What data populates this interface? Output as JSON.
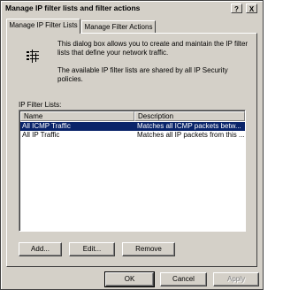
{
  "window": {
    "title": "Manage IP filter lists and filter actions",
    "help_glyph": "?",
    "close_glyph": "X"
  },
  "tabs": [
    {
      "label": "Manage IP Filter Lists",
      "active": true
    },
    {
      "label": "Manage Filter Actions",
      "active": false
    }
  ],
  "description": {
    "icon": "filter-list-icon",
    "line1": "This dialog box allows you to create and maintain the IP filter",
    "line2": "lists that define your network traffic.",
    "line3": "The available IP filter lists are shared by all IP Security",
    "line4": "policies."
  },
  "filter_list": {
    "label": "IP Filter Lists:",
    "columns": [
      "Name",
      "Description"
    ],
    "rows": [
      {
        "name": "All ICMP Traffic",
        "description": "Matches all ICMP packets betw...",
        "selected": true
      },
      {
        "name": "All IP Traffic",
        "description": "Matches all IP packets from this ...",
        "selected": false
      }
    ]
  },
  "actions": {
    "add": "Add...",
    "edit": "Edit...",
    "remove": "Remove"
  },
  "footer": {
    "ok": "OK",
    "cancel": "Cancel",
    "apply": "Apply"
  },
  "colors": {
    "face": "#d4d0c8",
    "selection": "#0a246a"
  }
}
